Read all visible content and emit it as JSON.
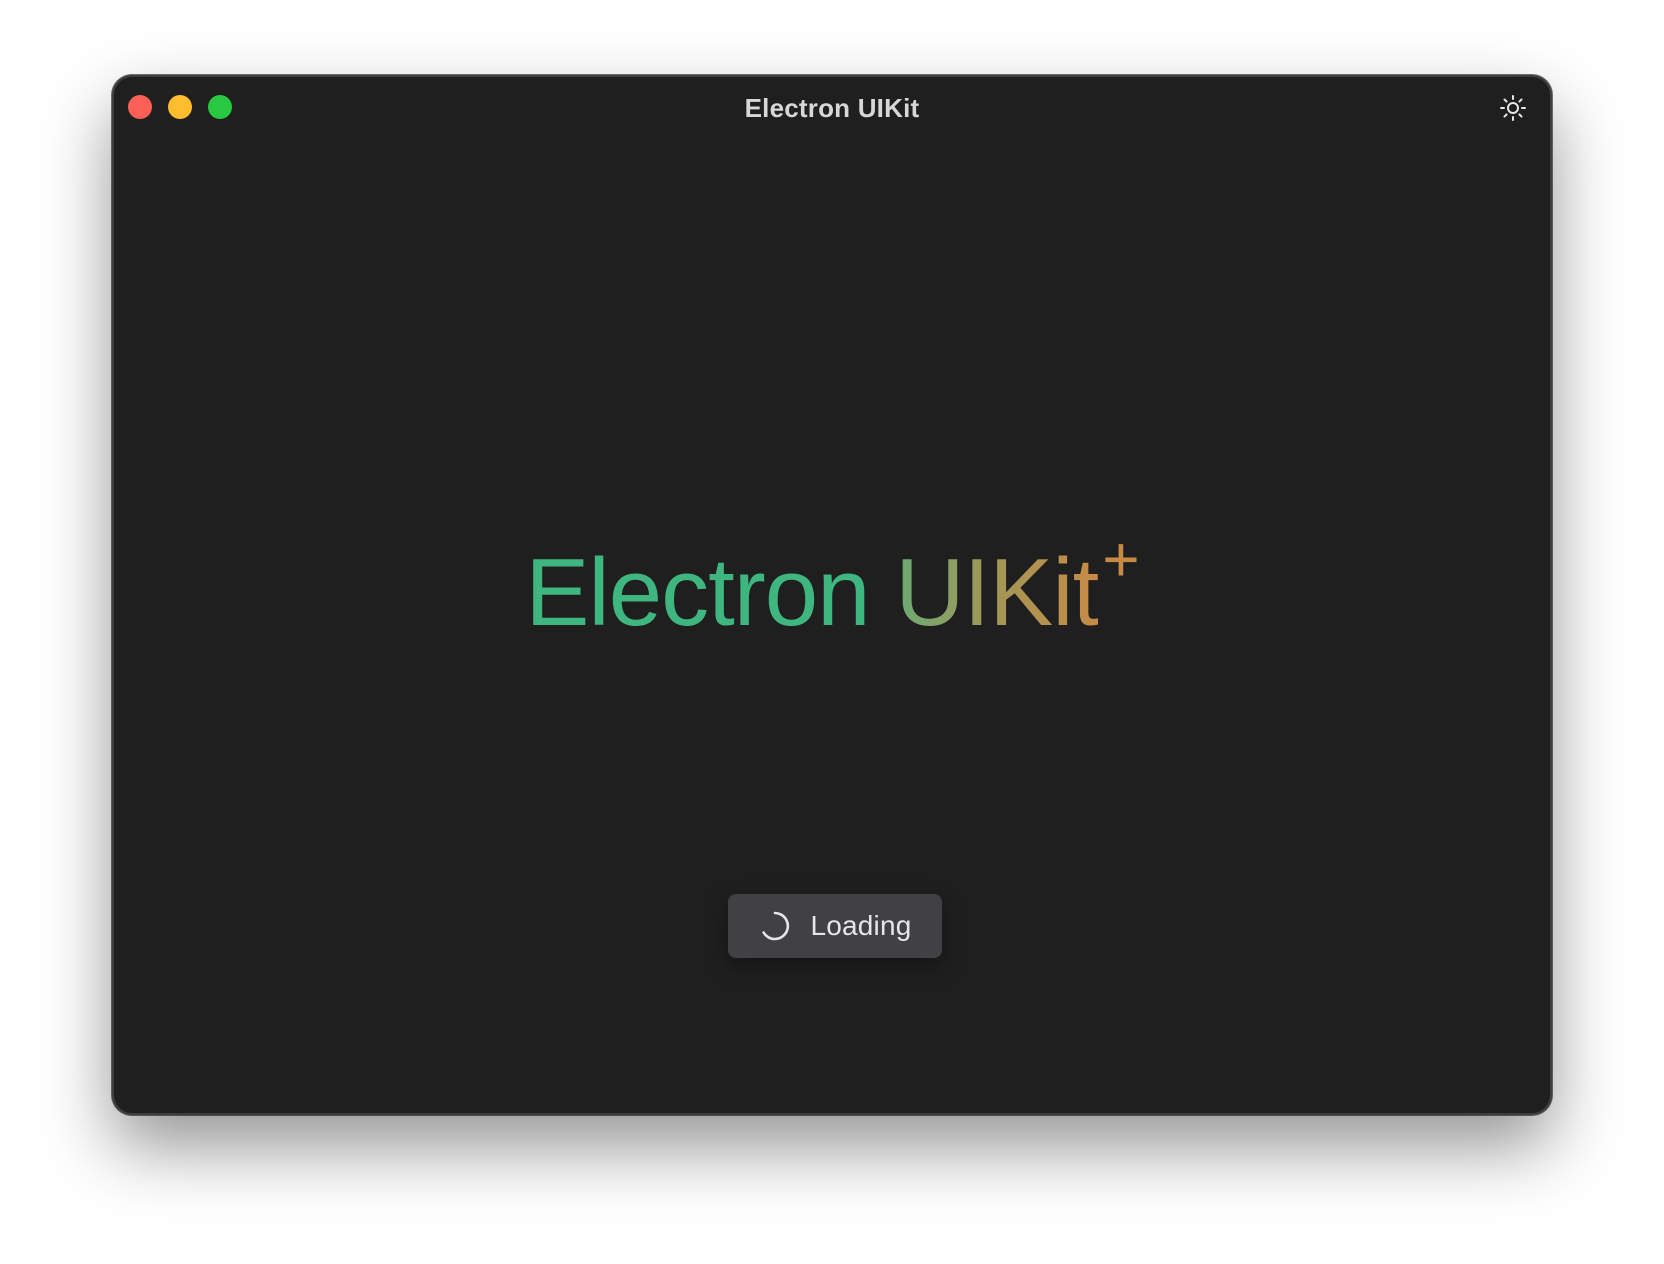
{
  "window": {
    "title": "Electron UIKit"
  },
  "titlebar": {
    "controls": [
      "close",
      "minimize",
      "maximize"
    ],
    "theme_toggle_icon": "sun-icon"
  },
  "hero": {
    "part1": "Electron",
    "part2": "UIKit",
    "superscript": "+"
  },
  "loading_button": {
    "icon": "spinner-icon",
    "label": "Loading"
  },
  "colors": {
    "window_bg": "#1f1f1f",
    "close": "#fe5f57",
    "minimize": "#febc2e",
    "maximize": "#28c840",
    "electron_green": "#3fb67f",
    "uikit_start": "#6aab73",
    "uikit_end": "#c78a45",
    "button_bg": "#404045"
  }
}
